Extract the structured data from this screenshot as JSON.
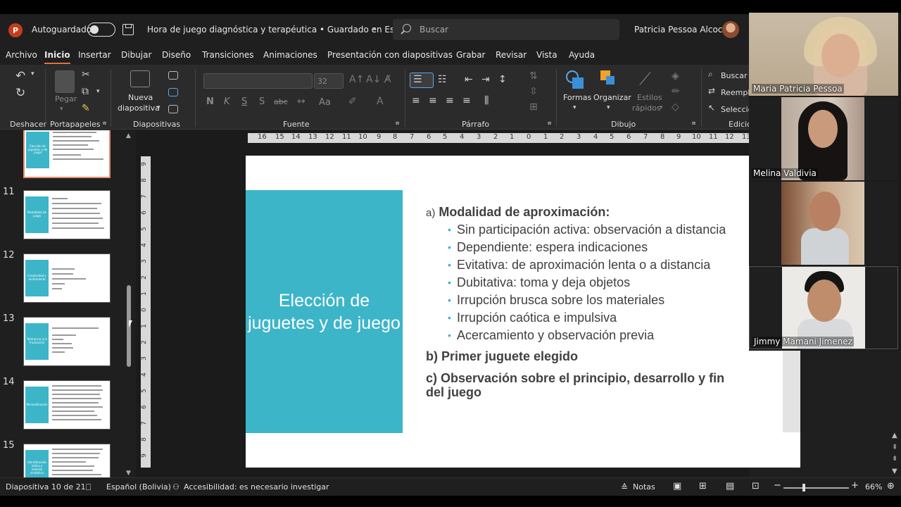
{
  "titlebar": {
    "app_icon": "P",
    "autosave_label": "Autoguardado",
    "document_title": "Hora de juego diagnóstica y terapéutica • Guardado en Este PC",
    "search_placeholder": "Buscar",
    "user_name": "Patricia Pessoa Alcocer"
  },
  "menu": {
    "items": [
      "Archivo",
      "Inicio",
      "Insertar",
      "Dibujar",
      "Diseño",
      "Transiciones",
      "Animaciones",
      "Presentación con diapositivas",
      "Grabar",
      "Revisar",
      "Vista",
      "Ayuda"
    ],
    "active": "Inicio"
  },
  "ribbon": {
    "groups": {
      "undo": "Deshacer",
      "clipboard": "Portapapeles",
      "slides": "Diapositivas",
      "font": "Fuente",
      "paragraph": "Párrafo",
      "drawing": "Dibujo",
      "editing": "Edició"
    },
    "paste_label": "Pegar",
    "new_slide_line1": "Nueva",
    "new_slide_line2": "diapositiva",
    "font_size": "32",
    "bold": "N",
    "italic": "K",
    "underline": "S",
    "shadow": "S",
    "strike": "abc",
    "case": "Aa",
    "shapes_label": "Formas",
    "arrange_label": "Organizar",
    "quick_styles_line1": "Estilos",
    "quick_styles_line2": "rápidos",
    "find_label": "Buscar",
    "replace_label": "Reempla",
    "select_label": "Seleccio"
  },
  "thumbnails": [
    {
      "num": "10",
      "title": "Elección de juguetes y de juego",
      "selected": true
    },
    {
      "num": "11",
      "title": "Modalidad de juego",
      "selected": false
    },
    {
      "num": "12",
      "title": "Creatividad y rendimiento",
      "selected": false
    },
    {
      "num": "13",
      "title": "Tolerancia a la frustración",
      "selected": false
    },
    {
      "num": "14",
      "title": "Personificación",
      "selected": false
    },
    {
      "num": "15",
      "title": "Identificación lúdica y relación simbólica",
      "selected": false
    }
  ],
  "ruler": {
    "horizontal": [
      "16",
      "15",
      "14",
      "13",
      "12",
      "11",
      "10",
      "9",
      "8",
      "7",
      "6",
      "5",
      "4",
      "3",
      "2",
      "1",
      "0",
      "1",
      "2",
      "3",
      "4",
      "5",
      "6",
      "7",
      "8",
      "9",
      "10",
      "11",
      "12",
      "13"
    ],
    "vertical": [
      "9",
      "8",
      "7",
      "6",
      "5",
      "4",
      "3",
      "2",
      "1",
      "0",
      "1",
      "2",
      "3",
      "4",
      "5",
      "6",
      "7",
      "8",
      "9"
    ]
  },
  "slide": {
    "title": "Elección de juguetes y de juego",
    "heading_a_label": "a)",
    "heading_a": "Modalidad de aproximación:",
    "bullets": [
      "Sin participación activa: observación a distancia",
      "Dependiente: espera indicaciones",
      "Evitativa: de aproximación lenta o a distancia",
      "Dubitativa: toma y deja objetos",
      "Irrupción brusca sobre los materiales",
      "Irrupción caótica e impulsiva",
      "Acercamiento y observación previa"
    ],
    "heading_b": "b) Primer juguete elegido",
    "heading_c": "c) Observación sobre el principio, desarrollo y fin del juego"
  },
  "participants": [
    {
      "name": "Maria Patricia Pessoa"
    },
    {
      "name": "Melina Valdivia"
    },
    {
      "name": ""
    },
    {
      "name": "Jimmy Mamani Jimenez"
    }
  ],
  "status": {
    "slide_counter": "Diapositiva 10 de 21",
    "language": "Español (Bolivia)",
    "accessibility": "Accesibilidad: es necesario investigar",
    "notes": "Notas",
    "zoom": "66%"
  }
}
